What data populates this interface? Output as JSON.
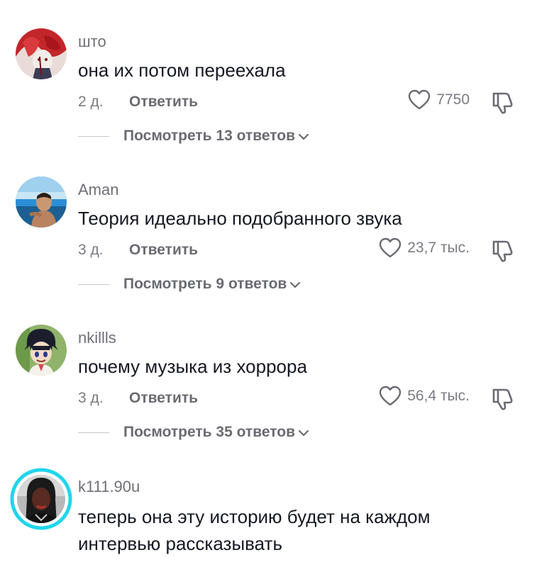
{
  "comments": [
    {
      "username": "што",
      "text": "она их потом переехала",
      "age": "2 д.",
      "reply_label": "Ответить",
      "likes": "7750",
      "replies_label": "Посмотреть 13 ответов",
      "avatar_colors": [
        "#c2262b",
        "#f1ece8",
        "#7a1217"
      ]
    },
    {
      "username": "Aman",
      "text": "Теория идеально подобранного звука",
      "age": "3 д.",
      "reply_label": "Ответить",
      "likes": "23,7 тыс.",
      "replies_label": "Посмотреть 9 ответов",
      "avatar_colors": [
        "#2b8fd6",
        "#c99872",
        "#1d3c5e"
      ]
    },
    {
      "username": "nkillls",
      "text": "почему музыка из хоррора",
      "age": "3 д.",
      "reply_label": "Ответить",
      "likes": "56,4 тыс.",
      "replies_label": "Посмотреть 35 ответов",
      "avatar_colors": [
        "#8fb36a",
        "#1c1d2c",
        "#f2dcc5"
      ]
    },
    {
      "username": "k111.90u",
      "text_line1": "теперь она эту историю будет на каждом",
      "text_line2": "интервью рассказывать",
      "avatar_colors": [
        "#1a1a1a",
        "#b8b8b8",
        "#5a2b22"
      ],
      "story_ring_color": "#20d5ec"
    }
  ],
  "icons": {
    "like": "heart-outline-icon",
    "dislike": "thumbs-down-icon",
    "expand": "chevron-down-icon"
  }
}
